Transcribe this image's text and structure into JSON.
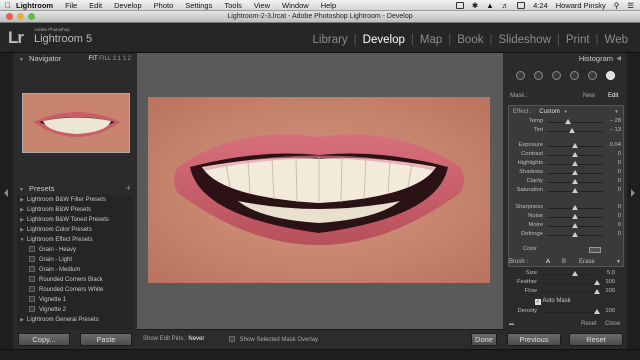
{
  "menubar": {
    "apple_icon": "apple-icon",
    "items": [
      "Lightroom",
      "File",
      "Edit",
      "Develop",
      "Photo",
      "Settings",
      "Tools",
      "View",
      "Window",
      "Help"
    ],
    "time": "4:24",
    "user": "Howard Pinsky"
  },
  "window": {
    "title": "Lightroom-2-3.lrcat - Adobe Photoshop Lightroom - Develop"
  },
  "header": {
    "logo": "Lr",
    "brand_small": "Adobe Photoshop",
    "brand": "Lightroom 5",
    "modules": [
      "Library",
      "Develop",
      "Map",
      "Book",
      "Slideshow",
      "Print",
      "Web"
    ],
    "active_module": "Develop"
  },
  "navigator": {
    "title": "Navigator",
    "zoom_options": [
      "FIT",
      "FILL",
      "1:1",
      "1:2"
    ]
  },
  "presets": {
    "title": "Presets",
    "add": "+",
    "items": [
      {
        "label": "Lightroom B&W Filter Presets",
        "type": "folder"
      },
      {
        "label": "Lightroom B&W Presets",
        "type": "folder"
      },
      {
        "label": "Lightroom B&W Toned Presets",
        "type": "folder"
      },
      {
        "label": "Lightroom Color Presets",
        "type": "folder"
      },
      {
        "label": "Lightroom Effect Presets",
        "type": "open"
      },
      {
        "label": "Grain - Heavy",
        "type": "child"
      },
      {
        "label": "Grain - Light",
        "type": "child"
      },
      {
        "label": "Grain - Medium",
        "type": "child"
      },
      {
        "label": "Rounded Corners Black",
        "type": "child"
      },
      {
        "label": "Rounded Corners White",
        "type": "child"
      },
      {
        "label": "Vignette 1",
        "type": "child"
      },
      {
        "label": "Vignette 2",
        "type": "child"
      },
      {
        "label": "Lightroom General Presets",
        "type": "folder"
      }
    ]
  },
  "left_buttons": {
    "copy": "Copy...",
    "paste": "Paste"
  },
  "toolbar": {
    "show_edit_pins_label": "Show Edit Pins :",
    "show_edit_pins_value": "Never",
    "mask_overlay_label": "Show Selected Mask Overlay",
    "done": "Done"
  },
  "histogram": {
    "title": "Histogram"
  },
  "mask": {
    "label": "Mask :",
    "new": "New",
    "edit": "Edit"
  },
  "effect": {
    "label": "Effect :",
    "value": "Custom"
  },
  "sliders": [
    {
      "label": "Temp",
      "value": "– 28",
      "pos": 0.38
    },
    {
      "label": "Tint",
      "value": "– 13",
      "pos": 0.45
    },
    {
      "label": "Exposure",
      "value": "0.04",
      "pos": 0.5
    },
    {
      "label": "Contrast",
      "value": "0",
      "pos": 0.5
    },
    {
      "label": "Highlights",
      "value": "0",
      "pos": 0.5
    },
    {
      "label": "Shadows",
      "value": "0",
      "pos": 0.5
    },
    {
      "label": "Clarity",
      "value": "0",
      "pos": 0.5
    },
    {
      "label": "Saturation",
      "value": "0",
      "pos": 0.5
    },
    {
      "label": "Sharpness",
      "value": "0",
      "pos": 0.5
    },
    {
      "label": "Noise",
      "value": "0",
      "pos": 0.5
    },
    {
      "label": "Moire",
      "value": "0",
      "pos": 0.5
    },
    {
      "label": "Defringe",
      "value": "0",
      "pos": 0.5
    }
  ],
  "color": {
    "label": "Color"
  },
  "brush": {
    "label": "Brush :",
    "a": "A",
    "b": "B",
    "erase": "Erase",
    "size": {
      "label": "Size",
      "value": "5.0",
      "pos": 0.6
    },
    "feather": {
      "label": "Feather",
      "value": "100",
      "pos": 1.0
    },
    "flow": {
      "label": "Flow",
      "value": "100",
      "pos": 1.0
    },
    "auto_mask": "Auto Mask",
    "density": {
      "label": "Density",
      "value": "100",
      "pos": 1.0
    }
  },
  "panel_footer": {
    "reset": "Reset",
    "close": "Close"
  },
  "right_buttons": {
    "previous": "Previous",
    "reset": "Reset"
  }
}
